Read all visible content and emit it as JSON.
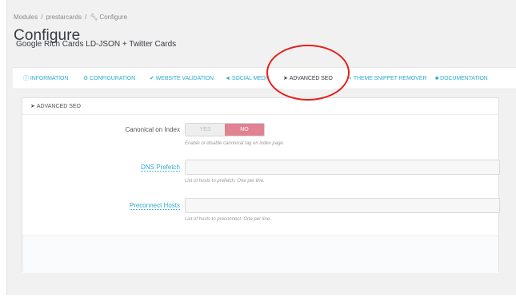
{
  "breadcrumb": {
    "items": [
      "Modules",
      "prestarcards"
    ],
    "current": "Configure",
    "current_icon": "wrench-icon"
  },
  "header": {
    "title": "Configure",
    "subtitle": "Google Rich Cards LD-JSON + Twitter Cards"
  },
  "tabs": [
    {
      "label": "INFORMATION",
      "icon": "info-icon",
      "glyph": "ⓘ",
      "active": false
    },
    {
      "label": "CONFIGURATION",
      "icon": "cogs-icon",
      "glyph": "⚙",
      "active": false
    },
    {
      "label": "WEBSITE VALIDATION",
      "icon": "check-icon",
      "glyph": "✔",
      "active": false
    },
    {
      "label": "SOCIAL MEDI",
      "icon": "bullhorn-icon",
      "glyph": "◄",
      "active": false
    },
    {
      "label": "ADVANCED SEO",
      "icon": "rocket-icon",
      "glyph": "➤",
      "active": true
    },
    {
      "label": "THEME SNIPPET REMOVER",
      "icon": "edit-icon",
      "glyph": "✎",
      "active": false
    },
    {
      "label": "DOCUMENTATION",
      "icon": "book-icon",
      "glyph": "■",
      "active": false
    }
  ],
  "panel": {
    "heading": "ADVANCED SEO",
    "heading_icon": "rocket-icon",
    "fields": {
      "canonical": {
        "label": "Canonical on Index",
        "yes": "YES",
        "no": "NO",
        "selected": "NO",
        "help": "Enable or disable canonical tag on index page."
      },
      "dns": {
        "label": "DNS Prefetch",
        "value": "",
        "help": "List of hosts to prefetch. One per line."
      },
      "preconnect": {
        "label": "Preconnect Hosts",
        "value": "",
        "help": "List of hosts to preconnect. One per line."
      }
    }
  },
  "colors": {
    "link": "#2eacce",
    "switch_no": "#e08291",
    "annotation": "#e3201b",
    "text_dark": "#363a41"
  }
}
